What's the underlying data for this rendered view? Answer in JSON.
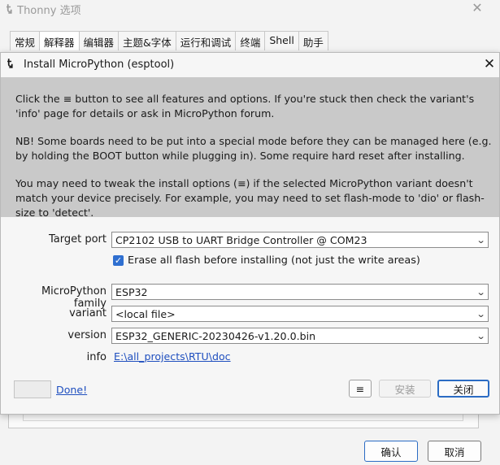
{
  "bg_window": {
    "title": "Thonny 选项",
    "tabs": [
      "常规",
      "解释器",
      "编辑器",
      "主题&字体",
      "运行和调试",
      "终端",
      "Shell",
      "助手"
    ],
    "active_tab": 1,
    "ok_label": "确认",
    "cancel_label": "取消"
  },
  "dialog": {
    "title": "Install MicroPython (esptool)",
    "info_p1": "Click the ≡ button to see all features and options. If you're stuck then check the variant's 'info' page for details or ask in MicroPython forum.",
    "info_p2": "NB! Some boards need to be put into a special mode before they can be managed here (e.g. by holding the BOOT button while plugging in). Some require hard reset after installing.",
    "info_p3": "You may need to tweak the install options (≡) if the selected MicroPython variant doesn't match your device precisely. For example, you may need to set flash-mode to 'dio' or flash-size to 'detect'.",
    "target_port_label": "Target port",
    "target_port_value": "CP2102 USB to UART Bridge Controller @ COM23",
    "erase_label": "Erase all flash before installing (not just the write areas)",
    "erase_checked": true,
    "family_label": "MicroPython family",
    "family_value": "ESP32",
    "variant_label": "variant",
    "variant_value": "<local file>",
    "version_label": "version",
    "version_value": "ESP32_GENERIC-20230426-v1.20.0.bin",
    "info_label": "info",
    "info_link": "E:\\all_projects\\RTU\\doc",
    "done_link": "Done!",
    "menu_button": "≡",
    "install_button": "安装",
    "close_button": "关闭"
  },
  "colors": {
    "accent": "#2b6cc4",
    "info_bg": "#c9c9c9",
    "link": "#1f4fbf"
  }
}
